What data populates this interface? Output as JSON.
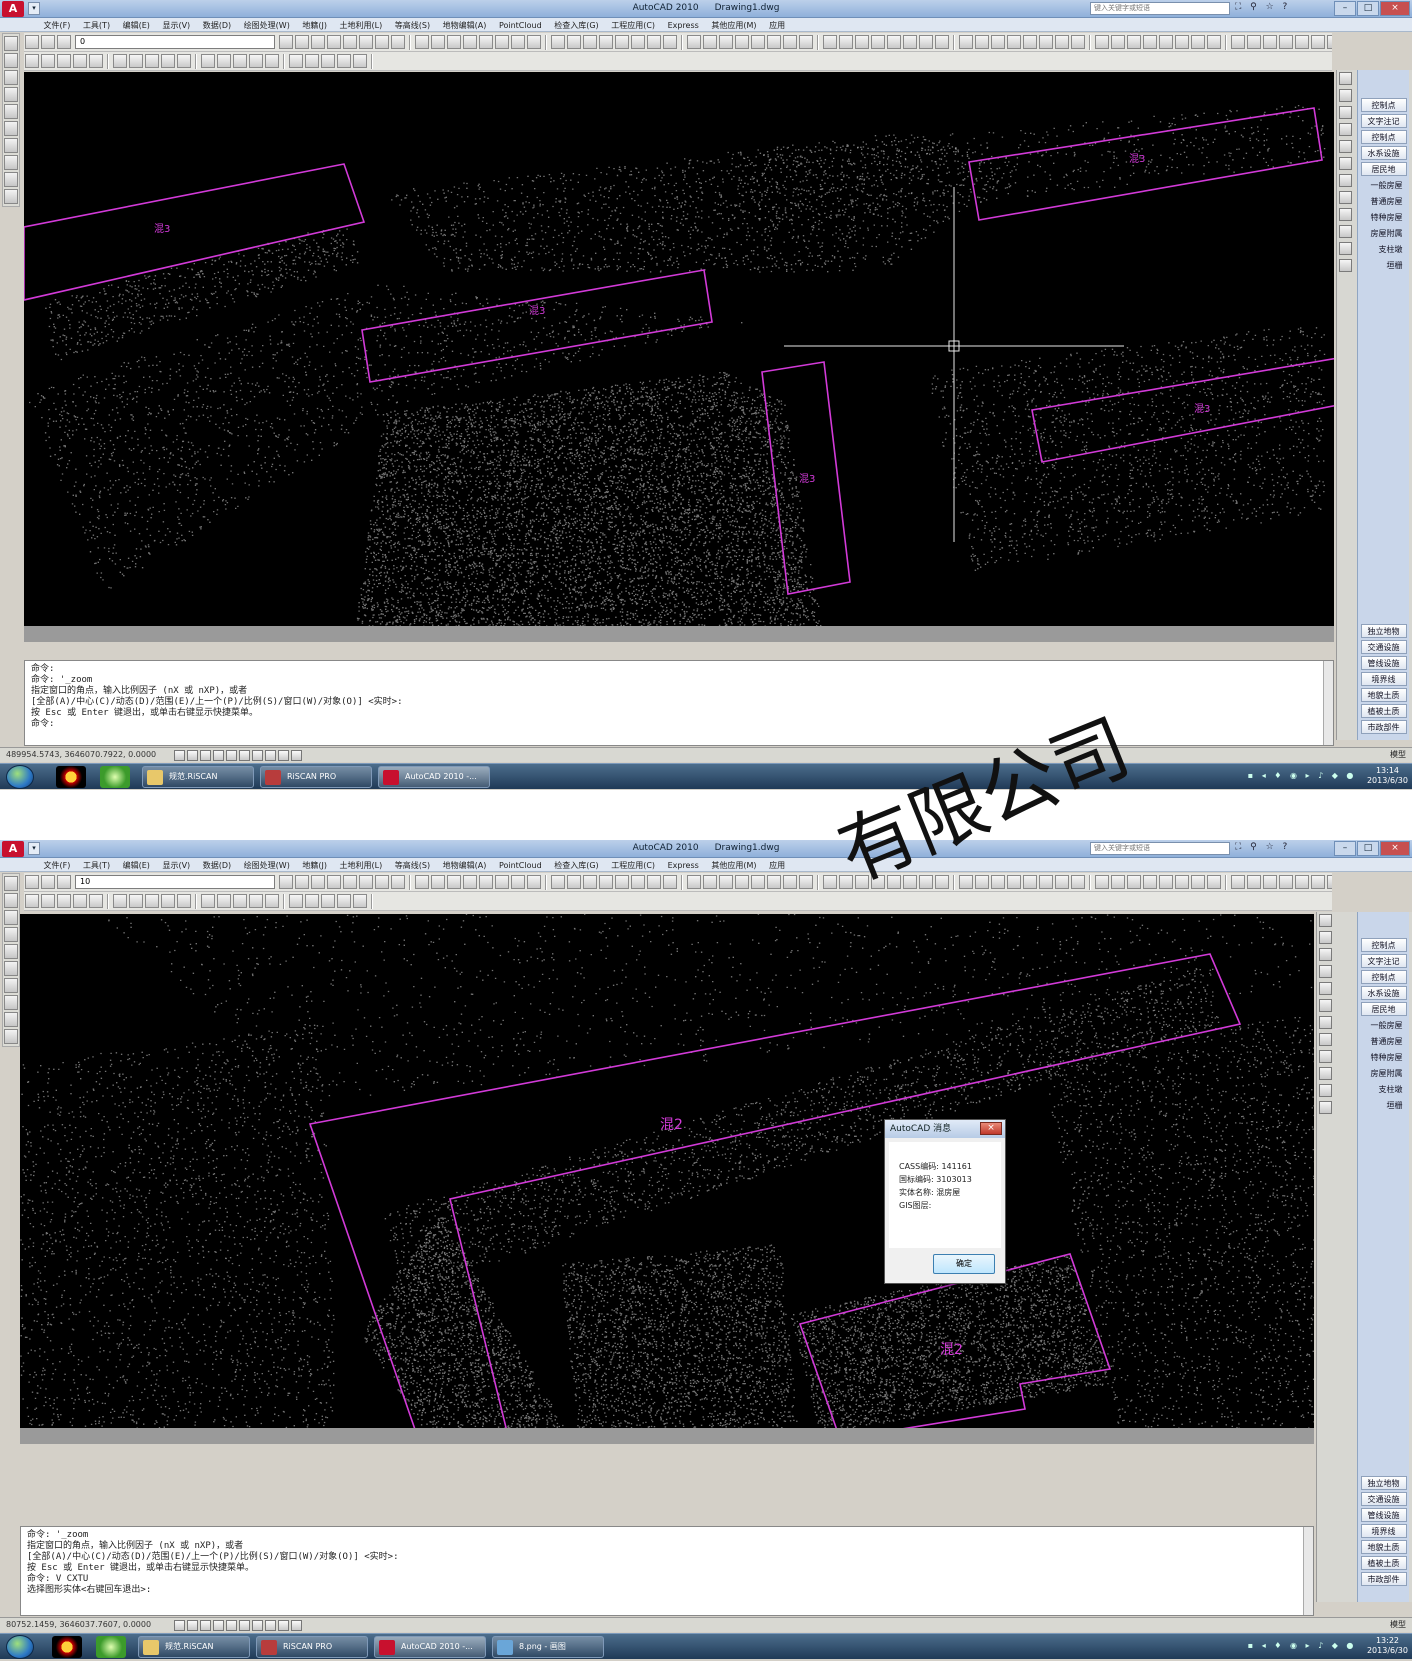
{
  "app": {
    "title": "AutoCAD 2010",
    "document": "Drawing1.dwg",
    "search_placeholder": "键入关键字或短语",
    "help_icons": "⛶ ⚲ ☆ ?",
    "window_buttons": [
      "–",
      "□",
      "×"
    ],
    "quick_access": "▾"
  },
  "menus": [
    "文件(F)",
    "工具(T)",
    "编辑(E)",
    "显示(V)",
    "数据(D)",
    "绘图处理(W)",
    "地籍(J)",
    "土地利用(L)",
    "等高线(S)",
    "地物编辑(A)",
    "PointCloud",
    "检查入库(G)",
    "工程应用(C)",
    "Express",
    "其他应用(M)",
    "应用"
  ],
  "screen1": {
    "layer": "0",
    "labels": [
      "混3",
      "混3",
      "混3",
      "混3",
      "混3"
    ],
    "command_lines": [
      "命令:",
      "命令: '_zoom",
      "指定窗口的角点，输入比例因子 (nX 或 nXP)，或者",
      "[全部(A)/中心(C)/动态(D)/范围(E)/上一个(P)/比例(S)/窗口(W)/对象(O)] <实时>:",
      "按 Esc 或 Enter 键退出，或单击右键显示快捷菜单。",
      "",
      "命令:"
    ],
    "coordinates": "489954.5743, 3646070.7922, 0.0000",
    "status_right": "模型",
    "taskbar": {
      "tasks": [
        "规范.RiSCAN",
        "RiSCAN PRO",
        "AutoCAD 2010 -..."
      ],
      "time": "13:14",
      "date": "2013/6/30"
    }
  },
  "screen2": {
    "layer": "10",
    "labels": [
      "混2",
      "混2"
    ],
    "dialog": {
      "title": "AutoCAD 消息",
      "lines": [
        "CASS编码: 141161",
        "国标编码: 3103013",
        "实体名称: 混房屋",
        "GIS图层:"
      ],
      "ok": "确定",
      "close": "×"
    },
    "command_lines": [
      "命令: '_zoom",
      "指定窗口的角点，输入比例因子 (nX 或 nXP)，或者",
      "[全部(A)/中心(C)/动态(D)/范围(E)/上一个(P)/比例(S)/窗口(W)/对象(O)] <实时>:",
      "按 Esc 或 Enter 键退出，或单击右键显示快捷菜单。",
      "命令: V CXTU",
      "",
      "选择图形实体<右键回车退出>:"
    ],
    "coordinates": "80752.1459, 3646037.7607, 0.0000",
    "status_right": "模型",
    "taskbar": {
      "tasks": [
        "规范.RiSCAN",
        "RiSCAN PRO",
        "AutoCAD 2010 -...",
        "8.png - 画图"
      ],
      "time": "13:22",
      "date": "2013/6/30"
    }
  },
  "palette": {
    "top": [
      "控制点",
      "文字注记",
      "控制点",
      "水系设施",
      "居民地"
    ],
    "sub": [
      "一般房屋",
      "普通房屋",
      "特种房屋",
      "房屋附属",
      "支柱墩",
      "垣栅"
    ],
    "bottom": [
      "独立地物",
      "交通设施",
      "管线设施",
      "境界线",
      "地貌土质",
      "植被土质",
      "市政部件"
    ]
  },
  "watermark": "有限公司",
  "colors": {
    "outline": "#d23ad8",
    "point_cloud": "#cfcfcf",
    "crosshair": "#e8e8e8",
    "canvas": "#000000"
  }
}
